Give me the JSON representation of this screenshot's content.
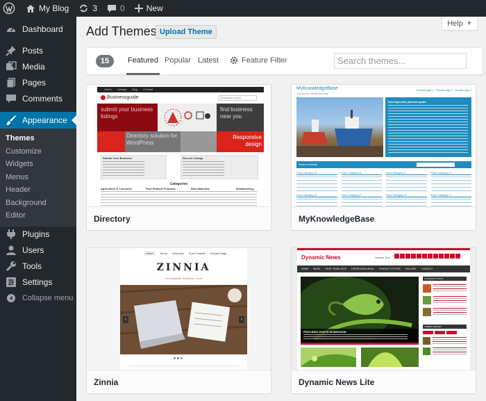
{
  "adminbar": {
    "site_name": "My Blog",
    "updates_count": "3",
    "comments_count": "0",
    "new_label": "New"
  },
  "sidebar": {
    "items": [
      {
        "label": "Dashboard",
        "icon": "dashboard-icon"
      },
      {
        "label": "Posts",
        "icon": "pin-icon"
      },
      {
        "label": "Media",
        "icon": "media-icon"
      },
      {
        "label": "Pages",
        "icon": "page-icon"
      },
      {
        "label": "Comments",
        "icon": "comment-icon"
      },
      {
        "label": "Appearance",
        "icon": "brush-icon"
      }
    ],
    "submenu": [
      "Themes",
      "Customize",
      "Widgets",
      "Menus",
      "Header",
      "Background",
      "Editor"
    ],
    "items_after": [
      {
        "label": "Plugins",
        "icon": "plugin-icon"
      },
      {
        "label": "Users",
        "icon": "users-icon"
      },
      {
        "label": "Tools",
        "icon": "wrench-icon"
      },
      {
        "label": "Settings",
        "icon": "settings-icon"
      }
    ],
    "collapse_label": "Collapse menu"
  },
  "header": {
    "title": "Add Themes",
    "upload_label": "Upload Theme",
    "help_label": "Help"
  },
  "filter": {
    "count": "15",
    "tabs": [
      "Featured",
      "Popular",
      "Latest"
    ],
    "active_tab": "Featured",
    "feature_filter_label": "Feature Filter",
    "search_placeholder": "Search themes..."
  },
  "themes": [
    {
      "name": "Directory",
      "preview": {
        "nav": [
          "Home",
          "Listings",
          "Blog",
          "Contact"
        ],
        "logo": "Businessguide",
        "search_btn": "Business search",
        "tagline_left": "submit your business listings",
        "tagline_right": "find business near you",
        "mid_left": "Directory solution for WordPress",
        "mid_right": "Responsive design",
        "box1_title": "Submit Your Business",
        "box2_title": "Recent Listings",
        "categories_title": "Categories",
        "cat_cols": [
          "Agriculture & Livestock",
          "Pool Related Products",
          "Raw Materials",
          "Metalworking"
        ]
      }
    },
    {
      "name": "MyKnowledgeBase",
      "preview": {
        "title": "MyKnowledgeBase",
        "subtitle": "Just another WordPress blog",
        "links": "Favorite page 1 · Favorite page 2 · Favorite page 3",
        "sidebar_heading": "Sed imperdiet placerat quam",
        "search_label": "Search website",
        "categories": [
          "Post Category A",
          "Post Category B",
          "Post Category C",
          "Post Category D",
          "Post Category E",
          "Post Category F",
          "Post Category G",
          "Post Category H"
        ],
        "item_label": "Example post"
      }
    },
    {
      "name": "Zinnia",
      "preview": {
        "nav": [
          "Home",
          "About",
          "Advertise",
          "Post Formats",
          "Sample Page"
        ],
        "logo": "ZINNIA",
        "tagline": "Free SimplyWP WordPress Theme"
      }
    },
    {
      "name": "Dynamic News Lite",
      "preview": {
        "logo": "Dynamic News",
        "header_text": "Header Text",
        "nav": [
          "HOME",
          "BLOG",
          "PAGE TEMPLATES",
          "DROPDOWN MENU",
          "CONTACT STYLES",
          "GALLERY",
          "CONTACT"
        ],
        "slide_title": "FEATURED POSTS SLIDESHOW",
        "widget_title": "TABBED WIDGET",
        "side_title": "CATEGORY POSTS"
      }
    }
  ],
  "colors": {
    "adminbar_bg": "#23282d",
    "accent": "#0073aa",
    "page_bg": "#f1f1f1"
  }
}
